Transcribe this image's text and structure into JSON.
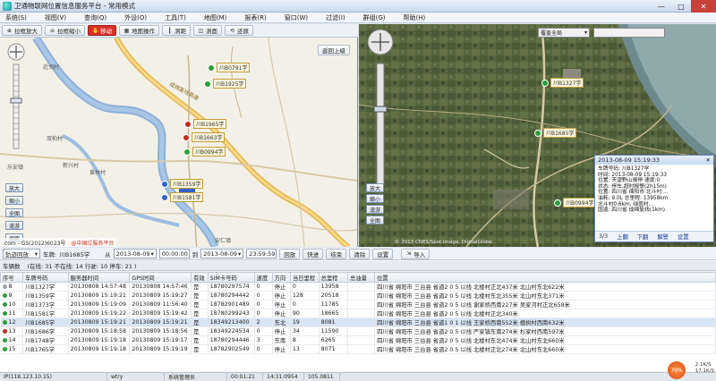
{
  "window": {
    "title": "卫通物联网位置信息服务平台 - 常用模式"
  },
  "menu": [
    "系统(S)",
    "视图(V)",
    "查询(Q)",
    "外设(O)",
    "工具(T)",
    "地图(M)",
    "报表(R)",
    "窗口(W)",
    "过滤(I)",
    "群组(G)",
    "帮助(H)"
  ],
  "map_toolbar": [
    {
      "label": "拉框放大",
      "icon": "zoom-in-icon"
    },
    {
      "label": "拉框缩小",
      "icon": "zoom-out-icon"
    },
    {
      "label": "移动",
      "icon": "hand-icon",
      "active": true
    },
    {
      "label": "地图操作",
      "icon": "map-icon"
    },
    {
      "label": "测距",
      "icon": "ruler-icon"
    },
    {
      "label": "测面",
      "icon": "area-icon"
    },
    {
      "label": "还原",
      "icon": "restore-icon"
    }
  ],
  "left_map": {
    "return_label": "返回上级",
    "side_buttons": [
      "放大",
      "缩小",
      "全图",
      "漫游",
      "测距"
    ],
    "vehicles": [
      {
        "plate": "川B0791学"
      },
      {
        "plate": "川B1925学"
      },
      {
        "plate": "川B1965学"
      },
      {
        "plate": "川B1663学"
      },
      {
        "plate": "川B0994学"
      },
      {
        "plate": "川B1359学"
      },
      {
        "plate": "川B1581学"
      }
    ],
    "places": [
      "近邻村",
      "双柏村",
      "乐安镇",
      "新兴村",
      "黄林村",
      "安仁镇"
    ],
    "highway_label": "成绵复线高速",
    "footer_text": ".com - GS(2012)6023号",
    "footer_badge": "@中国位服务平台"
  },
  "right_map": {
    "scale_label": "覆盖全局",
    "vehicles": [
      {
        "plate": "川B1327学"
      },
      {
        "plate": "川B1685学"
      },
      {
        "plate": "川B0994学"
      }
    ],
    "side_buttons": [
      "放大",
      "缩小",
      "漫游",
      "全图"
    ],
    "attribution": "© 2013 CNES/Spot Image, DigitalGlobe"
  },
  "popup": {
    "header": "2013-08-09 15:19:33",
    "lines": [
      "车牌号码: 川B1327学",
      "时间: 2013-08-09 15:19:33",
      "位置: 天望野山报停 速度:0",
      "状态: 停车,超时报警(2h15m)",
      "位置: 四川省 绵阳市 北斗村 ...",
      "油耗: 9.0L 总里程: 13958km",
      "北斗村0.6km, 绿茵村...",
      "国道: 四川省 成绵复线(1km)"
    ],
    "pager": "3/3",
    "actions": [
      "上翻",
      "下翻",
      "解警",
      "设置"
    ]
  },
  "query_bar": {
    "track_label": "轨迹回放",
    "plate_label": "车牌:",
    "plate_value": "川B1685学",
    "from_label": "从",
    "from_date": "2013-08-09",
    "from_time": "00:00:00",
    "to_label": "到",
    "to_date": "2013-08-09",
    "to_time": "23:59:59",
    "buttons": [
      "回放",
      "快进",
      "结束",
      "清除",
      "设置"
    ],
    "export": "导入"
  },
  "vehicle_status": {
    "title": "车辆数",
    "summary": "(在线: 31 不在线: 14 行驶: 10 停车: 21 )"
  },
  "table": {
    "columns": [
      "序号",
      "车牌号码",
      "服务器时间",
      "GPS时间",
      "有效",
      "SIM卡号码",
      "速度",
      "方向",
      "当日里程",
      "总里程",
      "总油量",
      "位置"
    ],
    "rows": [
      {
        "status": "#9aa5b1",
        "cells": [
          "8",
          "川B1327学",
          "20130808 14:57:48",
          "20130808 14:57:46",
          "是",
          "18780297574",
          "0",
          "停止",
          "0",
          "13958",
          "",
          "四川省 绵阳市 三台县 省道2 0 5 以线 北楼村正北437米 北山村东北622米"
        ]
      },
      {
        "status": "#2a9f3a",
        "cells": [
          "9",
          "川B1359学",
          "20130809 15:19:21",
          "20130809 15:19:27",
          "是",
          "18780294442",
          "0",
          "停止",
          "128",
          "20518",
          "",
          "四川省 绵阳市 三台县 省道2 0 5 以线 北楼村东北355米 北山村东北371米"
        ]
      },
      {
        "status": "#2a9f3a",
        "cells": [
          "10",
          "川B1373学",
          "20130809 15:19:09",
          "20130809 11:56:40",
          "是",
          "18782901489",
          "0",
          "停止",
          "0",
          "11785",
          "",
          "四川省 绵阳市 三台县 省道2 0 5 以线 谢家桥西南227米 吴家河村正北658米"
        ]
      },
      {
        "status": "#2a9f3a",
        "cells": [
          "11",
          "川B1581学",
          "20130809 15:19:22",
          "20130809 15:19:42",
          "是",
          "18780299243",
          "0",
          "停止",
          "90",
          "18665",
          "",
          "四川省 绵阳市 三台县 省道2 0 5 以线 北楼村正北340米"
        ]
      },
      {
        "status": "#2a9f3a",
        "sel": true,
        "cells": [
          "12",
          "川B1685学",
          "20130809 15:19:21",
          "20130809 15:19:21",
          "是",
          "18349213400",
          "2",
          "东北",
          "19",
          "8081",
          "",
          "四川省 绵阳市 三台县 省道1 0 1 以线 王家桥西南552米 檀树村西南632米"
        ]
      },
      {
        "status": "#c8281e",
        "cells": [
          "13",
          "川B1686学",
          "20130809 15:18:58",
          "20130809 15:18:56",
          "是",
          "18349224534",
          "0",
          "停止",
          "34",
          "11590",
          "",
          "四川省 绵阳市 三台县 省道2 0 5 以线 严家镇东南274米 杉家村西南597米"
        ]
      },
      {
        "status": "#2a9f3a",
        "cells": [
          "14",
          "川B1748学",
          "20130809 15:19:18",
          "20130809 15:19:17",
          "是",
          "18780294446",
          "3",
          "东南",
          "8",
          "6265",
          "",
          "四川省 绵阳市 三台县 省道2 0 5 以线 北楼村东北474米 北山村东北660米"
        ]
      },
      {
        "status": "#2a9f3a",
        "cells": [
          "15",
          "川B1765学",
          "20130809 15:19:18",
          "20130809 15:19:19",
          "是",
          "18782902549",
          "0",
          "停止",
          "13",
          "8071",
          "",
          "四川省 绵阳市 三台县 省道2 0 5 以线 北楼村正北274米 北山村东北660米"
        ]
      }
    ]
  },
  "statusbar": {
    "ip": "IP(118.123.10.15)",
    "user": "wtry",
    "mode": "系统管理员",
    "t1": "00:01:21",
    "t2": "14:31:0954",
    "t3": "105.0811",
    "net_badge": "70%",
    "net_up": "2.1K/S",
    "net_down": "17.1K/S"
  }
}
